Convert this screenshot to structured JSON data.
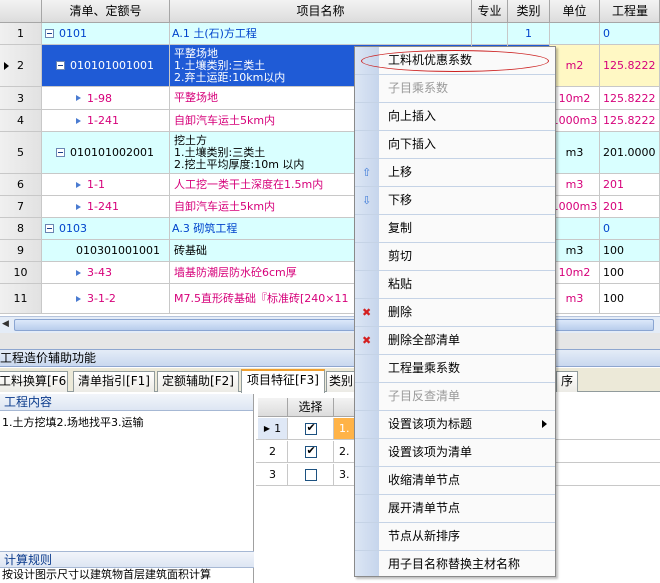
{
  "grid": {
    "headers": {
      "code": "清单、定额号",
      "name": "项目名称",
      "spec": "专业",
      "category": "类别",
      "unit": "单位",
      "qty": "工程量"
    },
    "rows": [
      {
        "rn": "1",
        "code": "0101",
        "name1": "A.1 土(石)方工程",
        "category": "1",
        "unit": "",
        "qty": "0"
      },
      {
        "rn": "2",
        "code": "010101001001",
        "name1": "平整场地",
        "name2": "1.土壤类别:三类土",
        "name3": "2.弃土运距:10km以内",
        "unit": "m2",
        "qty": "125.8222"
      },
      {
        "rn": "3",
        "code": "1-98",
        "name1": "平整场地",
        "unit": "10m2",
        "qty": "125.8222"
      },
      {
        "rn": "4",
        "code": "1-241",
        "name1": "自卸汽车运土5km内",
        "unit": "1000m3",
        "qty": "125.8222"
      },
      {
        "rn": "5",
        "code": "010101002001",
        "name1": "挖土方",
        "name2": "1.土壤类别:三类土",
        "name3": "2.挖土平均厚度:10m 以内",
        "unit": "m3",
        "qty": "201.0000"
      },
      {
        "rn": "6",
        "code": "1-1",
        "name1": "人工挖一类干土深度在1.5m内",
        "unit": "m3",
        "qty": "201"
      },
      {
        "rn": "7",
        "code": "1-241",
        "name1": "自卸汽车运土5km内",
        "unit": "1000m3",
        "qty": "201"
      },
      {
        "rn": "8",
        "code": "0103",
        "name1": "A.3 砌筑工程",
        "unit": "",
        "qty": "0"
      },
      {
        "rn": "9",
        "code": "010301001001",
        "name1": "砖基础",
        "unit": "m3",
        "qty": "100"
      },
      {
        "rn": "10",
        "code": "3-43",
        "name1": "墙基防潮层防水砼6cm厚",
        "unit": "10m2",
        "qty": "100"
      },
      {
        "rn": "11",
        "code": "3-1-2",
        "name1": "M7.5直形砖基础『标准砖[240×11",
        "unit": "m3",
        "qty": "100"
      }
    ]
  },
  "panel": {
    "title": "工程造价辅助功能",
    "tabs": [
      "工料换算[F6]",
      "清单指引[F1]",
      "定额辅助[F2]",
      "项目特征[F3]",
      "类别",
      "序"
    ],
    "work_content_header": "工程内容",
    "work_content_text": "1.土方挖填2.场地找平3.运输",
    "rule_header": "计算规则",
    "rule_text": "按设计图示尺寸以建筑物首层建筑面积计算",
    "feature_grid": {
      "select_header": "选择",
      "rows": [
        {
          "rn": "1",
          "checked": true,
          "text": "1."
        },
        {
          "rn": "2",
          "checked": true,
          "text": "2."
        },
        {
          "rn": "3",
          "checked": false,
          "text": "3."
        }
      ]
    }
  },
  "context_menu": {
    "items": [
      {
        "label": "工料机优惠系数",
        "disabled": false,
        "icon": ""
      },
      {
        "label": "子目乘系数",
        "disabled": true,
        "icon": ""
      },
      {
        "label": "向上插入",
        "disabled": false,
        "icon": ""
      },
      {
        "label": "向下插入",
        "disabled": false,
        "icon": ""
      },
      {
        "label": "上移",
        "disabled": false,
        "icon": "up-arrow-icon"
      },
      {
        "label": "下移",
        "disabled": false,
        "icon": "down-arrow-icon"
      },
      {
        "label": "复制",
        "disabled": false,
        "icon": ""
      },
      {
        "label": "剪切",
        "disabled": false,
        "icon": ""
      },
      {
        "label": "粘贴",
        "disabled": false,
        "icon": ""
      },
      {
        "label": "删除",
        "disabled": false,
        "icon": "delete-x-icon"
      },
      {
        "label": "删除全部清单",
        "disabled": false,
        "icon": "delete-x-icon"
      },
      {
        "label": "工程量乘系数",
        "disabled": false,
        "icon": ""
      },
      {
        "label": "子目反查清单",
        "disabled": true,
        "icon": ""
      },
      {
        "label": "设置该项为标题",
        "disabled": false,
        "icon": "",
        "submenu": true
      },
      {
        "label": "设置该项为清单",
        "disabled": false,
        "icon": ""
      },
      {
        "label": "收缩清单节点",
        "disabled": false,
        "icon": ""
      },
      {
        "label": "展开清单节点",
        "disabled": false,
        "icon": ""
      },
      {
        "label": "节点从新排序",
        "disabled": false,
        "icon": ""
      },
      {
        "label": "用子目名称替换主材名称",
        "disabled": false,
        "icon": ""
      }
    ]
  },
  "colors": {
    "selection_blue": "#1f5bd6",
    "cyan_row": "#d9ffff",
    "pink_text": "#d6007a",
    "annotation_red": "#cc2020"
  }
}
